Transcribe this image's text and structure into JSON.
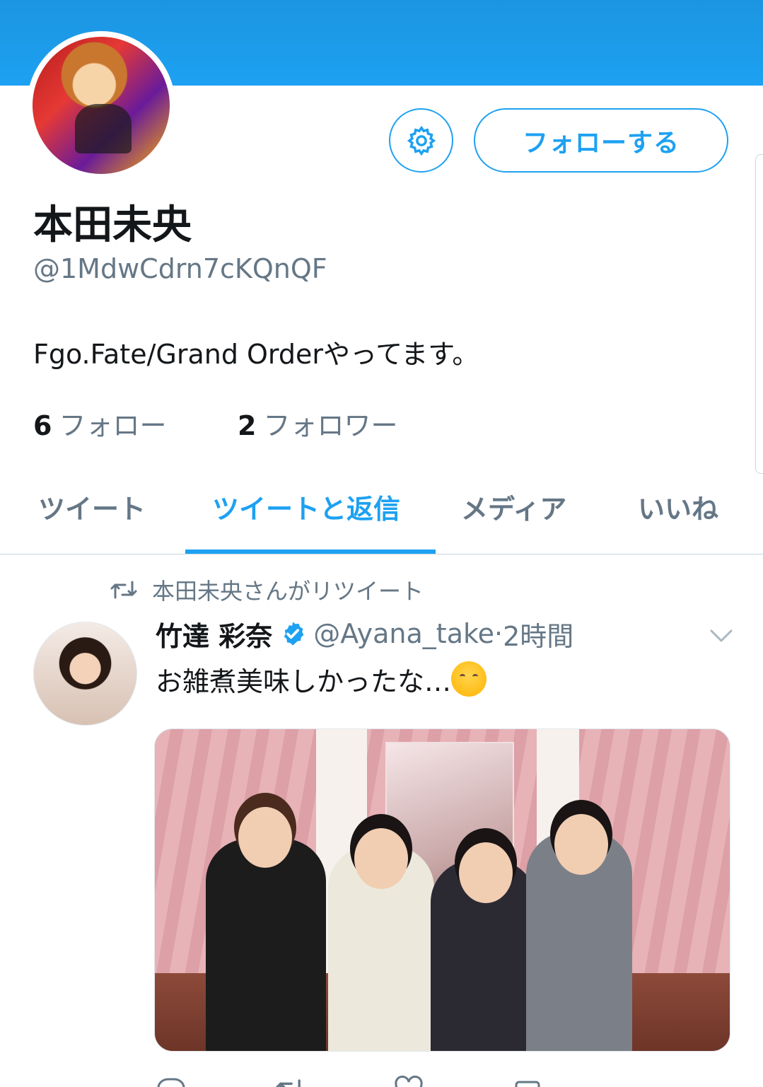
{
  "profile": {
    "name": "本田未央",
    "handle": "@1MdwCdrn7cKQnQF",
    "bio": "Fgo.Fate/Grand Orderやってます。",
    "follow_button": "フォローする",
    "stats": {
      "following_count": "6",
      "following_label": "フォロー",
      "followers_count": "2",
      "followers_label": "フォロワー"
    }
  },
  "tabs": [
    {
      "label": "ツイート",
      "active": false
    },
    {
      "label": "ツイートと返信",
      "active": true
    },
    {
      "label": "メディア",
      "active": false
    },
    {
      "label": "いいね",
      "active": false
    }
  ],
  "tweet": {
    "retweet_context": "本田未央さんがリツイート",
    "author_name": "竹達 彩奈",
    "author_handle": "@Ayana_take",
    "separator": "·",
    "time": "2時間",
    "text": "お雑煮美味しかったな…",
    "verified": true
  },
  "icons": {
    "settings": "gear-icon",
    "retweet": "retweet-icon",
    "verified": "verified-badge-icon",
    "caret": "chevron-down-icon"
  },
  "colors": {
    "accent": "#1da1f2",
    "text_primary": "#14171a",
    "text_secondary": "#657786",
    "border": "#ccd6dd"
  }
}
